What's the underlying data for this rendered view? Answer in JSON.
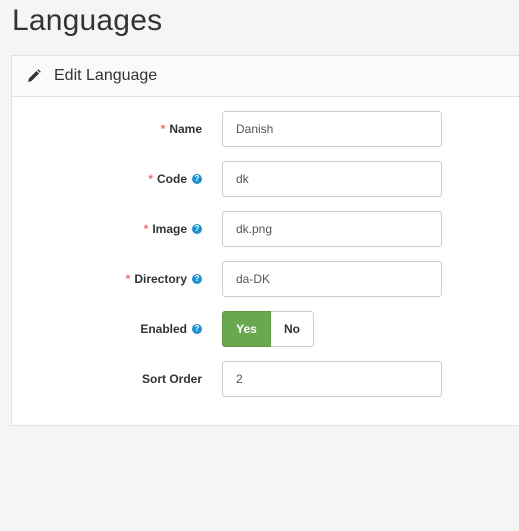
{
  "page": {
    "title": "Languages"
  },
  "panel": {
    "heading": "Edit Language"
  },
  "form": {
    "required_mark": "*",
    "help_mark": "?",
    "name": {
      "label": "Name",
      "value": "Danish"
    },
    "code": {
      "label": "Code",
      "value": "dk"
    },
    "image": {
      "label": "Image",
      "value": "dk.png"
    },
    "directory": {
      "label": "Directory",
      "value": "da-DK"
    },
    "enabled": {
      "label": "Enabled",
      "yes_label": "Yes",
      "no_label": "No",
      "selected": "Yes"
    },
    "sort_order": {
      "label": "Sort Order",
      "value": "2"
    }
  },
  "colors": {
    "active_toggle": "#6aa84f",
    "help_icon": "#1e91cf",
    "required": "#f56b6b"
  }
}
